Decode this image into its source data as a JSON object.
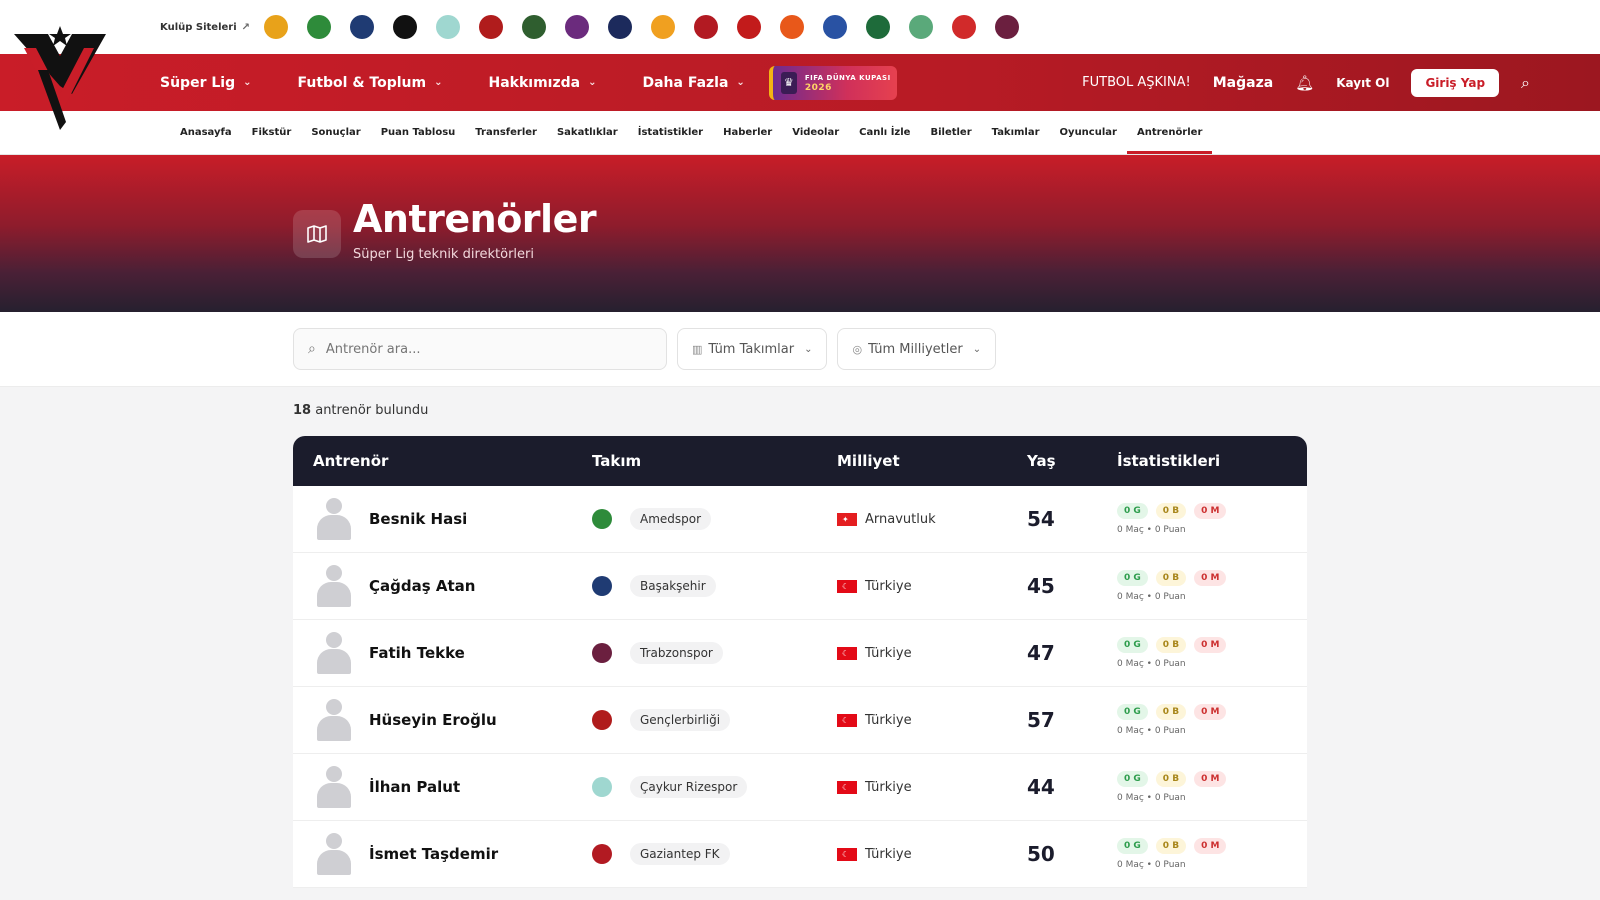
{
  "clubbar": {
    "label": "Kulüp Siteleri",
    "clubs": [
      {
        "name": "alanyaspor",
        "color": "#e8a21a"
      },
      {
        "name": "amedspor",
        "color": "#2e8b3a"
      },
      {
        "name": "basaksehir",
        "color": "#1f3b73"
      },
      {
        "name": "besiktas",
        "color": "#111111"
      },
      {
        "name": "rizespor",
        "color": "#9fd7d0"
      },
      {
        "name": "genclerbirligi",
        "color": "#b01c1c"
      },
      {
        "name": "kocaelispor",
        "color": "#2f5e2f"
      },
      {
        "name": "eyupspor",
        "color": "#6b2b7d"
      },
      {
        "name": "fenerbahce",
        "color": "#1c2a5c"
      },
      {
        "name": "galatasaray",
        "color": "#f0a020"
      },
      {
        "name": "gaziantep",
        "color": "#b21a22"
      },
      {
        "name": "karagumruk",
        "color": "#c21b1b"
      },
      {
        "name": "goztepe",
        "color": "#e8581a"
      },
      {
        "name": "kasimpasa",
        "color": "#2952a3"
      },
      {
        "name": "kocaeli",
        "color": "#1e6b3a"
      },
      {
        "name": "konyaspor",
        "color": "#5aa97a"
      },
      {
        "name": "samsunspor",
        "color": "#d12a2a"
      },
      {
        "name": "trabzonspor",
        "color": "#6b1f3f"
      }
    ]
  },
  "nav": {
    "items": [
      "Süper Lig",
      "Futbol & Toplum",
      "Hakkımızda",
      "Daha Fazla"
    ],
    "wc_line1": "FIFA DÜNYA KUPASI",
    "wc_line2": "2026",
    "slogan": "FUTBOL AŞKINA!",
    "store": "Mağaza",
    "register": "Kayıt Ol",
    "login": "Giriş Yap"
  },
  "subnav": [
    "Anasayfa",
    "Fikstür",
    "Sonuçlar",
    "Puan Tablosu",
    "Transferler",
    "Sakatlıklar",
    "İstatistikler",
    "Haberler",
    "Videolar",
    "Canlı İzle",
    "Biletler",
    "Takımlar",
    "Oyuncular",
    "Antrenörler"
  ],
  "hero": {
    "title": "Antrenörler",
    "subtitle": "Süper Lig teknik direktörleri"
  },
  "filters": {
    "search_placeholder": "Antrenör ara...",
    "teams": "Tüm Takımlar",
    "nationalities": "Tüm Milliyetler"
  },
  "count": {
    "number": "18",
    "text": " antrenör bulundu"
  },
  "table": {
    "headers": [
      "Antrenör",
      "Takım",
      "Milliyet",
      "Yaş",
      "İstatistikleri"
    ],
    "rows": [
      {
        "name": "Besnik Hasi",
        "team": "Amedspor",
        "team_color": "#2e8b3a",
        "nationality": "Arnavutluk",
        "age": "54",
        "w": "0 G",
        "d": "0 B",
        "l": "0 M",
        "sub": "0 Maç • 0 Puan"
      },
      {
        "name": "Çağdaş Atan",
        "team": "Başakşehir",
        "team_color": "#1f3b73",
        "nationality": "Türkiye",
        "age": "45",
        "w": "0 G",
        "d": "0 B",
        "l": "0 M",
        "sub": "0 Maç • 0 Puan"
      },
      {
        "name": "Fatih Tekke",
        "team": "Trabzonspor",
        "team_color": "#6b1f3f",
        "nationality": "Türkiye",
        "age": "47",
        "w": "0 G",
        "d": "0 B",
        "l": "0 M",
        "sub": "0 Maç • 0 Puan"
      },
      {
        "name": "Hüseyin Eroğlu",
        "team": "Gençlerbirliği",
        "team_color": "#b01c1c",
        "nationality": "Türkiye",
        "age": "57",
        "w": "0 G",
        "d": "0 B",
        "l": "0 M",
        "sub": "0 Maç • 0 Puan"
      },
      {
        "name": "İlhan Palut",
        "team": "Çaykur Rizespor",
        "team_color": "#9fd7d0",
        "nationality": "Türkiye",
        "age": "44",
        "w": "0 G",
        "d": "0 B",
        "l": "0 M",
        "sub": "0 Maç • 0 Puan"
      },
      {
        "name": "İsmet Taşdemir",
        "team": "Gaziantep FK",
        "team_color": "#b21a22",
        "nationality": "Türkiye",
        "age": "50",
        "w": "0 G",
        "d": "0 B",
        "l": "0 M",
        "sub": "0 Maç • 0 Puan"
      }
    ]
  }
}
